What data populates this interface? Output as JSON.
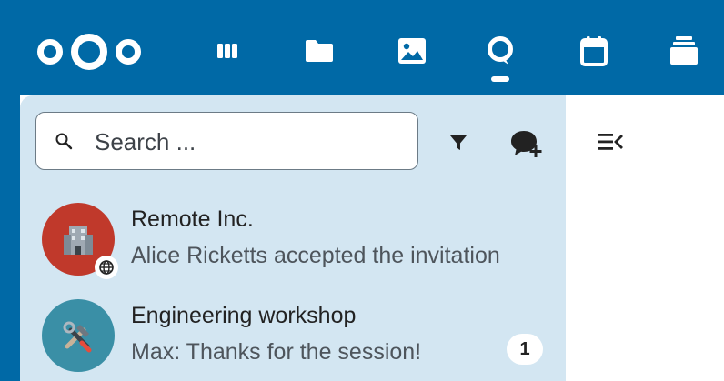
{
  "header": {
    "logo": "nextcloud-logo",
    "apps": [
      {
        "name": "dashboard",
        "icon": "dashboard-icon"
      },
      {
        "name": "files",
        "icon": "folder-icon"
      },
      {
        "name": "photos",
        "icon": "image-icon"
      },
      {
        "name": "talk",
        "icon": "talk-icon",
        "active": true
      },
      {
        "name": "calendar",
        "icon": "calendar-icon"
      },
      {
        "name": "deck",
        "icon": "stack-icon"
      }
    ],
    "brand_color": "#0069a6"
  },
  "sidebar": {
    "search": {
      "placeholder": "Search ...",
      "value": ""
    },
    "background_color": "#d3e6f2",
    "conversations": [
      {
        "name": "Remote Inc.",
        "last_message": "Alice Ricketts accepted the invitation",
        "avatar_icon": "building-icon",
        "avatar_color": "#c0392b",
        "badge_icon": "globe-icon"
      },
      {
        "name": "Engineering workshop",
        "last_message": "Max: Thanks for the session!",
        "avatar_icon": "tools-icon",
        "avatar_color": "#3a8fa6",
        "unread_count": "1"
      }
    ]
  }
}
